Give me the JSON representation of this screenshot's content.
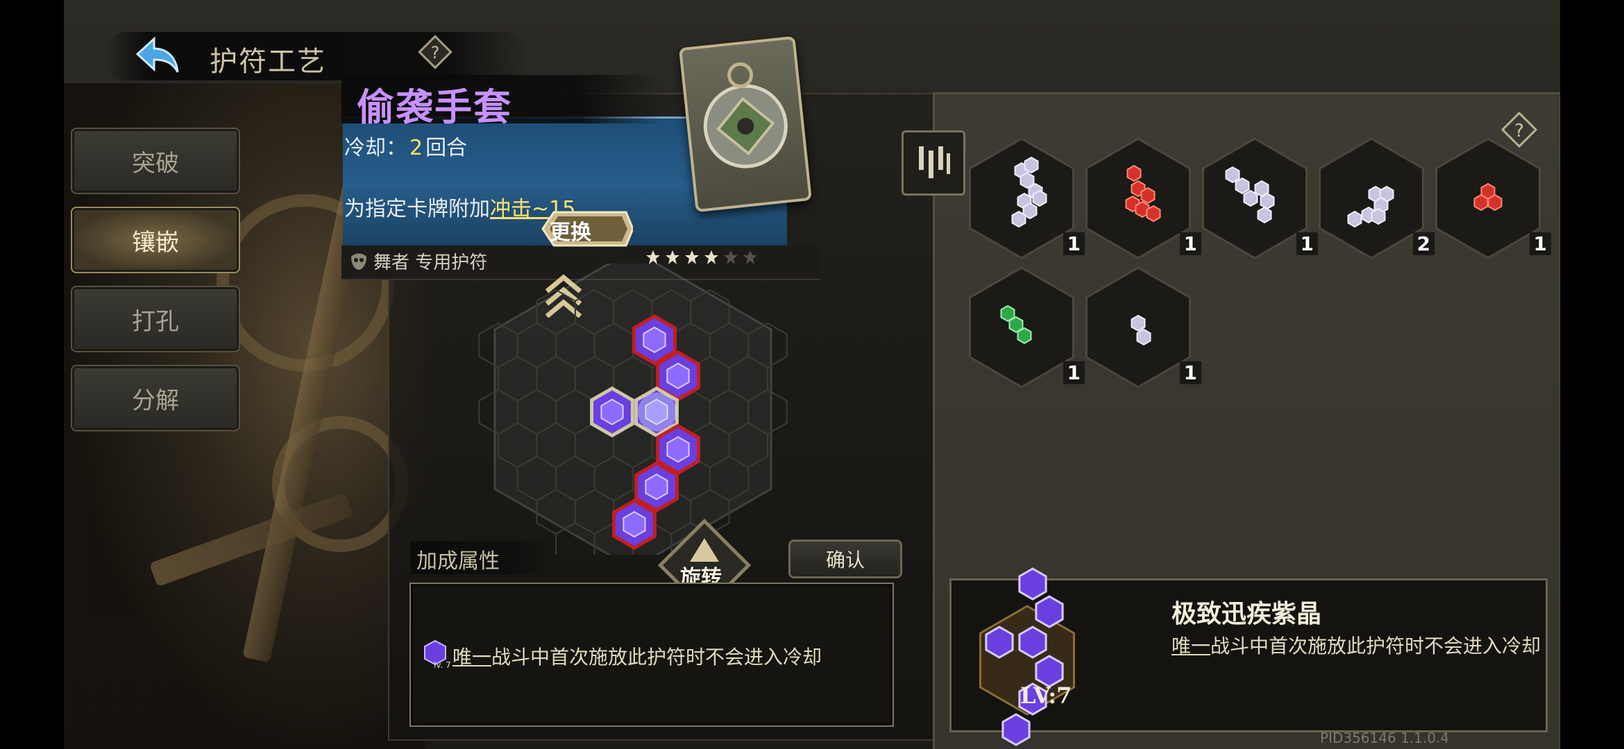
{
  "header": {
    "title": "护符工艺"
  },
  "nav": [
    {
      "label": "突破",
      "active": false
    },
    {
      "label": "镶嵌",
      "active": true
    },
    {
      "label": "打孔",
      "active": false
    },
    {
      "label": "分解",
      "active": false
    }
  ],
  "charm": {
    "name": "偷袭手套",
    "cooldown_prefix": "冷却：",
    "cooldown_value": "2",
    "cooldown_unit": "回合",
    "effect_prefix": "为指定卡牌附加",
    "effect_keyword": "冲击~15",
    "owner": "舞者 专用护符",
    "stars_filled": 4,
    "stars_total": 6,
    "swap_label": "更换"
  },
  "board": {
    "bonus_title": "加成属性",
    "rotate_label": "旋转",
    "confirm_label": "确认",
    "bonus_gem_level": "lv. 7",
    "bonus_keyword": "唯一",
    "bonus_text": "战斗中首次施放此护符时不会进入冷却"
  },
  "inventory": {
    "slots": [
      {
        "color": "white",
        "count": "1"
      },
      {
        "color": "red",
        "count": "1"
      },
      {
        "color": "white",
        "count": "1"
      },
      {
        "color": "white",
        "count": "2"
      },
      {
        "color": "red",
        "count": "1"
      },
      {
        "color": "green",
        "count": "1"
      },
      {
        "color": "white",
        "count": "1"
      }
    ]
  },
  "detail": {
    "name": "极致迅疾紫晶",
    "keyword": "唯一",
    "text": "战斗中首次施放此护符时不会进入冷却",
    "level": "LV:7"
  },
  "footer": {
    "pid": "PID356146  1.1.0.4"
  },
  "colors": {
    "accent_purple": "#c791ff",
    "highlight_yellow": "#ffe46a",
    "gem_red": "#d6302a",
    "gem_green": "#2ea74a",
    "gem_violet": "#6a3fe0"
  },
  "icons": [
    "back-arrow-icon",
    "help-icon",
    "filter-icon",
    "rotate-icon",
    "star-icon",
    "mask-icon"
  ]
}
